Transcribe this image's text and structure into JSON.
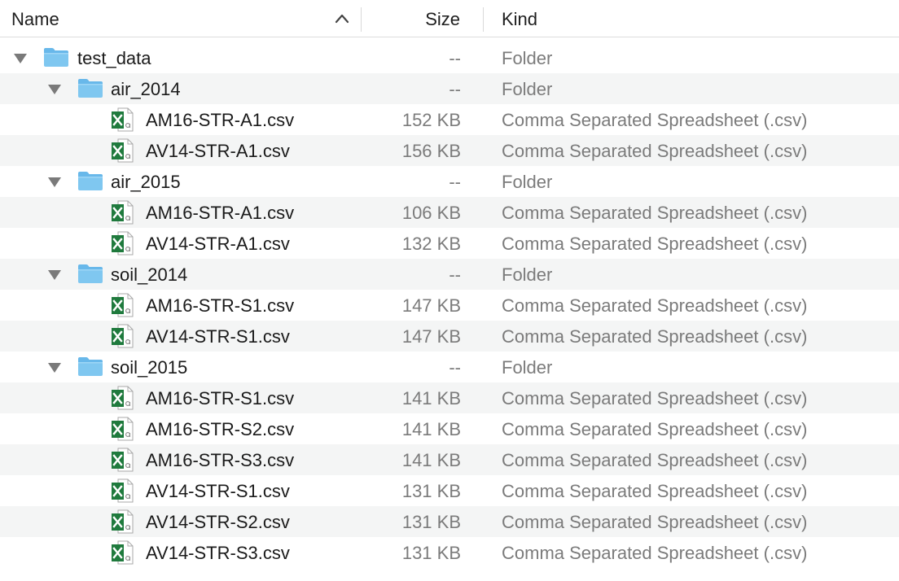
{
  "header": {
    "name_label": "Name",
    "size_label": "Size",
    "kind_label": "Kind",
    "sort_indicator": "chevron-up-icon"
  },
  "colors": {
    "folder_blue": "#7fc7f0",
    "excel_green": "#1f7a3d",
    "alt_row": "#f4f5f5",
    "secondary_text": "#7b7b7b"
  },
  "rows": [
    {
      "type": "folder",
      "level": 0,
      "expanded": true,
      "name": "test_data",
      "size": "--",
      "kind": "Folder"
    },
    {
      "type": "folder",
      "level": 1,
      "expanded": true,
      "name": "air_2014",
      "size": "--",
      "kind": "Folder"
    },
    {
      "type": "file",
      "level": 2,
      "name": "AM16-STR-A1.csv",
      "size": "152 KB",
      "kind": "Comma Separated Spreadsheet (.csv)"
    },
    {
      "type": "file",
      "level": 2,
      "name": "AV14-STR-A1.csv",
      "size": "156 KB",
      "kind": "Comma Separated Spreadsheet (.csv)"
    },
    {
      "type": "folder",
      "level": 1,
      "expanded": true,
      "name": "air_2015",
      "size": "--",
      "kind": "Folder"
    },
    {
      "type": "file",
      "level": 2,
      "name": "AM16-STR-A1.csv",
      "size": "106 KB",
      "kind": "Comma Separated Spreadsheet (.csv)"
    },
    {
      "type": "file",
      "level": 2,
      "name": "AV14-STR-A1.csv",
      "size": "132 KB",
      "kind": "Comma Separated Spreadsheet (.csv)"
    },
    {
      "type": "folder",
      "level": 1,
      "expanded": true,
      "name": "soil_2014",
      "size": "--",
      "kind": "Folder"
    },
    {
      "type": "file",
      "level": 2,
      "name": "AM16-STR-S1.csv",
      "size": "147 KB",
      "kind": "Comma Separated Spreadsheet (.csv)"
    },
    {
      "type": "file",
      "level": 2,
      "name": "AV14-STR-S1.csv",
      "size": "147 KB",
      "kind": "Comma Separated Spreadsheet (.csv)"
    },
    {
      "type": "folder",
      "level": 1,
      "expanded": true,
      "name": "soil_2015",
      "size": "--",
      "kind": "Folder"
    },
    {
      "type": "file",
      "level": 2,
      "name": "AM16-STR-S1.csv",
      "size": "141 KB",
      "kind": "Comma Separated Spreadsheet (.csv)"
    },
    {
      "type": "file",
      "level": 2,
      "name": "AM16-STR-S2.csv",
      "size": "141 KB",
      "kind": "Comma Separated Spreadsheet (.csv)"
    },
    {
      "type": "file",
      "level": 2,
      "name": "AM16-STR-S3.csv",
      "size": "141 KB",
      "kind": "Comma Separated Spreadsheet (.csv)"
    },
    {
      "type": "file",
      "level": 2,
      "name": "AV14-STR-S1.csv",
      "size": "131 KB",
      "kind": "Comma Separated Spreadsheet (.csv)"
    },
    {
      "type": "file",
      "level": 2,
      "name": "AV14-STR-S2.csv",
      "size": "131 KB",
      "kind": "Comma Separated Spreadsheet (.csv)"
    },
    {
      "type": "file",
      "level": 2,
      "name": "AV14-STR-S3.csv",
      "size": "131 KB",
      "kind": "Comma Separated Spreadsheet (.csv)"
    }
  ]
}
